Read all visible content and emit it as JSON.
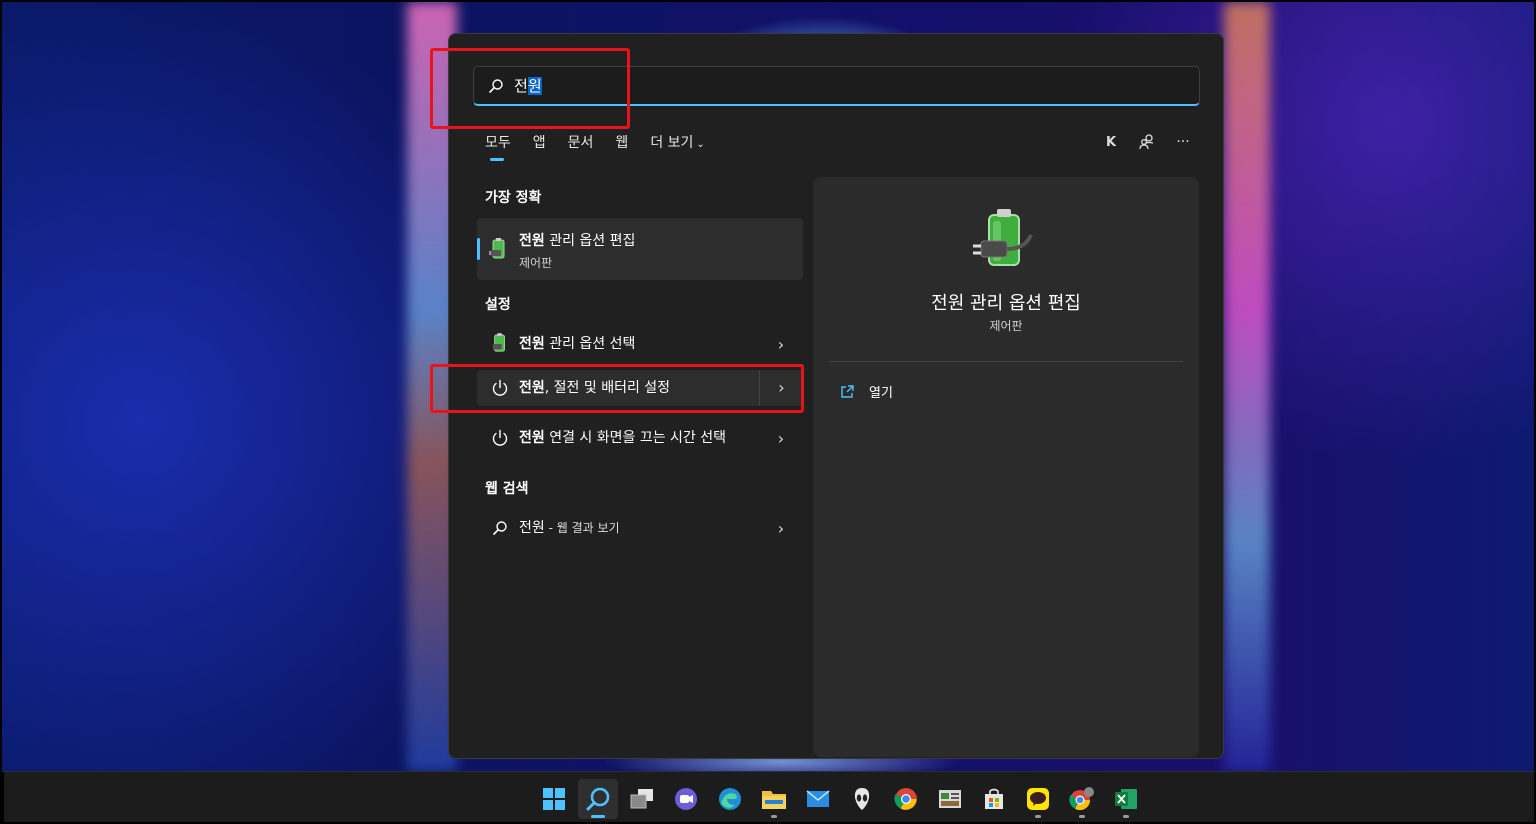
{
  "search": {
    "typed": "전",
    "selected": "원"
  },
  "tabs": [
    {
      "label": "모두",
      "active": true
    },
    {
      "label": "앱"
    },
    {
      "label": "문서"
    },
    {
      "label": "웹"
    },
    {
      "label": "더 보기"
    }
  ],
  "toolbar": {
    "account_initial": "K",
    "more": "···"
  },
  "sections": {
    "best_match": "가장 정확",
    "settings": "설정",
    "web_search": "웹 검색"
  },
  "best_match": {
    "title_bold": "전원",
    "title_rest": " 관리 옵션 편집",
    "subtitle": "제어판"
  },
  "settings_items": [
    {
      "bold": "전원",
      "rest": " 관리 옵션 선택"
    },
    {
      "bold": "전원",
      "rest": ", 절전 및 배터리 설정"
    },
    {
      "bold": "전원",
      "rest": " 연결 시 화면을 끄는 시간 선택"
    }
  ],
  "web_item": {
    "query": "전원",
    "suffix": " - 웹 결과 보기"
  },
  "detail": {
    "title": "전원 관리 옵션 편집",
    "subtitle": "제어판",
    "action": "열기"
  },
  "taskbar": [
    "start-icon",
    "search-icon",
    "task-view-icon",
    "chat-icon",
    "edge-icon",
    "file-explorer-icon",
    "mail-icon",
    "alienware-icon",
    "chrome-icon",
    "app-icon",
    "store-icon",
    "kakaotalk-icon",
    "chrome-profile-icon",
    "excel-icon"
  ],
  "colors": {
    "accent": "#4cc2ff",
    "highlight_box": "#e8141c",
    "panel": "#202020"
  }
}
